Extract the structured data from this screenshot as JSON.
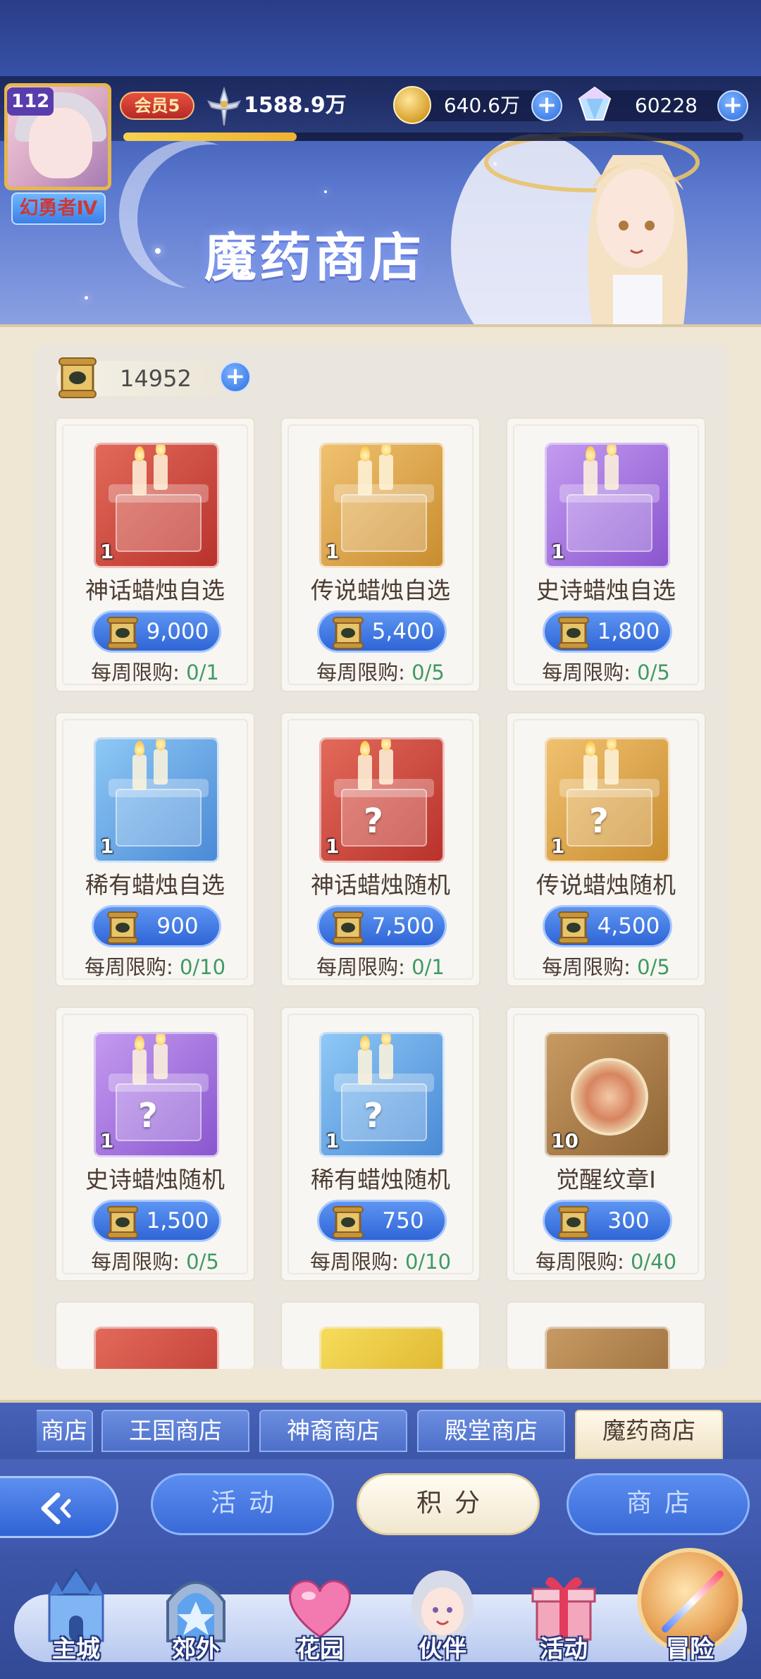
{
  "player": {
    "level": "112",
    "title": "幻勇者Ⅳ",
    "vip": "会员5",
    "power": "1588.9万",
    "exp_progress": 0.28
  },
  "resources": {
    "gold": "640.6万",
    "diamonds": "60228"
  },
  "shop": {
    "title": "魔药商店",
    "currency_value": "14952",
    "limit_label": "每周限购:",
    "items": [
      {
        "name": "神话蜡烛自选",
        "qty": "1",
        "price": "9,000",
        "limit": "0/1",
        "icon": "mythic-candle-box-icon",
        "color": "#e26a5a"
      },
      {
        "name": "传说蜡烛自选",
        "qty": "1",
        "price": "5,400",
        "limit": "0/5",
        "icon": "legendary-candle-box-icon",
        "color": "#f0c170"
      },
      {
        "name": "史诗蜡烛自选",
        "qty": "1",
        "price": "1,800",
        "limit": "0/5",
        "icon": "epic-candle-box-icon",
        "color": "#c39af0"
      },
      {
        "name": "稀有蜡烛自选",
        "qty": "1",
        "price": "900",
        "limit": "0/10",
        "icon": "rare-candle-box-icon",
        "color": "#8ec8f5"
      },
      {
        "name": "神话蜡烛随机",
        "qty": "1",
        "price": "7,500",
        "limit": "0/1",
        "icon": "mythic-candle-random-icon",
        "color": "#e26a5a"
      },
      {
        "name": "传说蜡烛随机",
        "qty": "1",
        "price": "4,500",
        "limit": "0/5",
        "icon": "legendary-candle-random-icon",
        "color": "#f0c170"
      },
      {
        "name": "史诗蜡烛随机",
        "qty": "1",
        "price": "1,500",
        "limit": "0/5",
        "icon": "epic-candle-random-icon",
        "color": "#c39af0"
      },
      {
        "name": "稀有蜡烛随机",
        "qty": "1",
        "price": "750",
        "limit": "0/10",
        "icon": "rare-candle-random-icon",
        "color": "#8ec8f5"
      },
      {
        "name": "觉醒纹章I",
        "qty": "10",
        "price": "300",
        "limit": "0/40",
        "icon": "awakening-emblem-icon",
        "color": "#c89a62"
      }
    ]
  },
  "shop_tabs": [
    "商店",
    "王国商店",
    "神裔商店",
    "殿堂商店",
    "魔药商店"
  ],
  "categories": [
    "活动",
    "积分",
    "商店"
  ],
  "nav": [
    "主城",
    "郊外",
    "花园",
    "伙伴",
    "活动",
    "冒险"
  ],
  "colors": {
    "accent_blue": "#2f65d6",
    "limit_green": "#3f9a63",
    "panel_bg": "#efe6d4"
  }
}
